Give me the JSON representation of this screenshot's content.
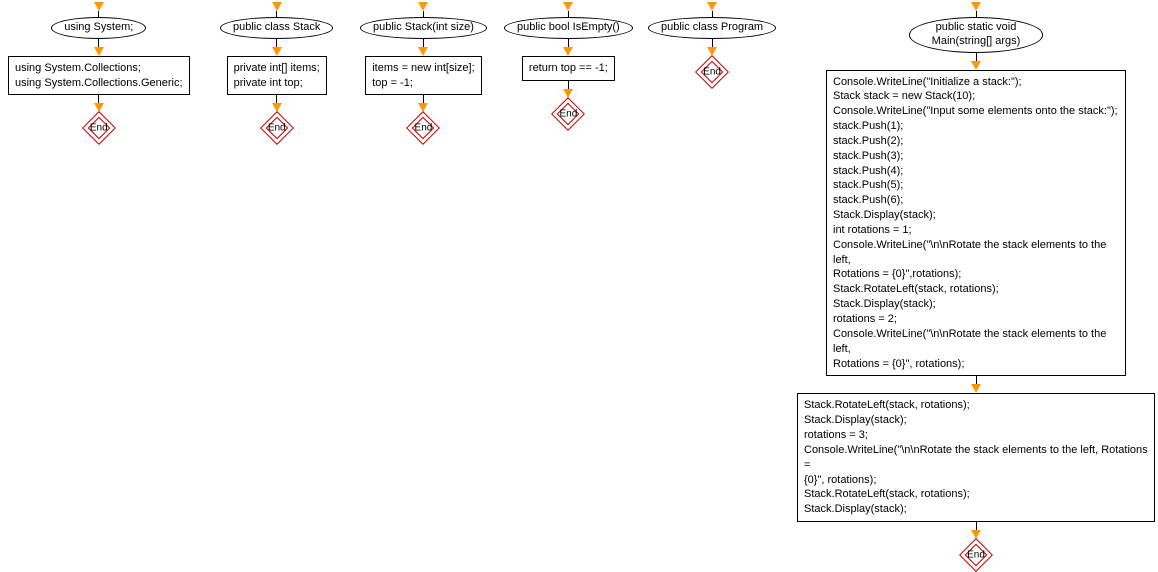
{
  "flows": {
    "f1": {
      "title": "using System;",
      "body": "using System.Collections;\nusing System.Collections.Generic;",
      "end": "End"
    },
    "f2": {
      "title": "public class Stack",
      "body": "private int[] items;\nprivate int top;",
      "end": "End"
    },
    "f3": {
      "title": "public Stack(int size)",
      "body": "items = new int[size];\ntop = -1;",
      "end": "End"
    },
    "f4": {
      "title": "public bool IsEmpty()",
      "body": "return top == -1;",
      "end": "End"
    },
    "f5": {
      "title": "public class Program",
      "end": "End"
    },
    "f6": {
      "title": "public static void\nMain(string[] args)",
      "body1": "Console.WriteLine(\"Initialize a stack:\");\nStack stack = new Stack(10);\nConsole.WriteLine(\"Input some elements onto the stack:\");\nstack.Push(1);\nstack.Push(2);\nstack.Push(3);\nstack.Push(4);\nstack.Push(5);\nstack.Push(6);\nStack.Display(stack);\nint rotations = 1;\nConsole.WriteLine(\"\\n\\nRotate the stack elements to the left,\nRotations = {0}\",rotations);\nStack.RotateLeft(stack, rotations);\nStack.Display(stack);\nrotations = 2;\nConsole.WriteLine(\"\\n\\nRotate the stack elements to the left,\nRotations = {0}\", rotations);",
      "body2": "Stack.RotateLeft(stack, rotations);\nStack.Display(stack);\nrotations = 3;\nConsole.WriteLine(\"\\n\\nRotate the stack elements to the left, Rotations =\n{0}\", rotations);\nStack.RotateLeft(stack, rotations);\nStack.Display(stack);",
      "end": "End"
    }
  }
}
